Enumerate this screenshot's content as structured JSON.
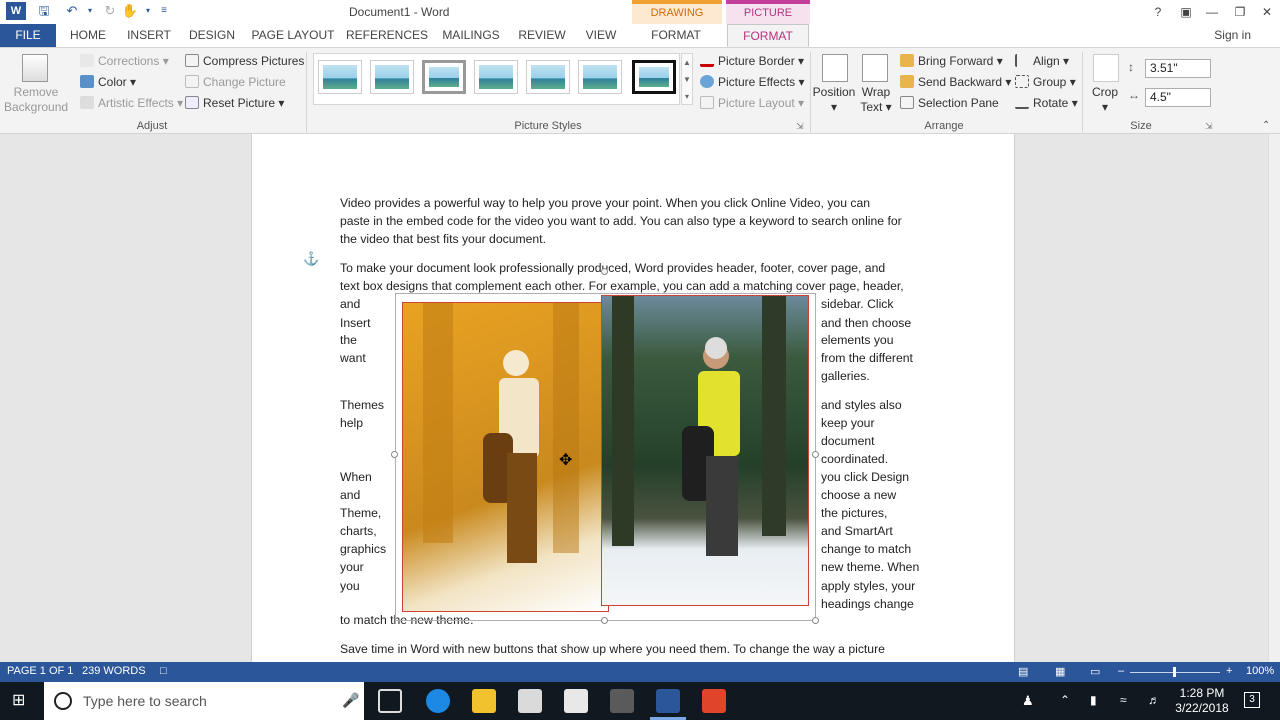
{
  "titlebar": {
    "document_title": "Document1 - Word",
    "context_drawing_tools": "DRAWING TOOLS",
    "context_picture_tools": "PICTURE TOOLS",
    "help": "?"
  },
  "tabs": {
    "file": "FILE",
    "home": "HOME",
    "insert": "INSERT",
    "design": "DESIGN",
    "page_layout": "PAGE LAYOUT",
    "references": "REFERENCES",
    "mailings": "MAILINGS",
    "review": "REVIEW",
    "view": "VIEW",
    "format_drawing": "FORMAT",
    "format_picture": "FORMAT",
    "sign_in": "Sign in"
  },
  "ribbon": {
    "adjust": {
      "remove_background": "Remove Background",
      "corrections": "Corrections",
      "color": "Color",
      "artistic_effects": "Artistic Effects",
      "compress_pictures": "Compress Pictures",
      "change_picture": "Change Picture",
      "reset_picture": "Reset Picture",
      "label": "Adjust"
    },
    "picture_styles": {
      "picture_border": "Picture Border",
      "picture_effects": "Picture Effects",
      "picture_layout": "Picture Layout",
      "label": "Picture Styles"
    },
    "arrange": {
      "position": "Position",
      "wrap_text": "Wrap Text",
      "bring_forward": "Bring Forward",
      "send_backward": "Send Backward",
      "selection_pane": "Selection Pane",
      "align": "Align",
      "group": "Group",
      "rotate": "Rotate",
      "label": "Arrange"
    },
    "size": {
      "crop": "Crop",
      "height": "3.51\"",
      "width": "4.5\"",
      "label": "Size"
    }
  },
  "document": {
    "para1": [
      "Video provides a powerful way to help you prove your point. When you click Online Video, you can",
      "paste in the embed code for the video you want to add. You can also type a keyword to search online for",
      "the video that best fits your document."
    ],
    "para2": [
      "To make your document look professionally produced, Word provides header, footer, cover page, and",
      "text box designs that complement each other. For example, you can add a matching cover page, header,"
    ],
    "wrap_left": [
      "and",
      "Insert",
      "the",
      "want",
      "Themes",
      "help",
      "When",
      "and",
      "Theme,",
      "charts,",
      "graphics",
      "your",
      "you"
    ],
    "wrap_right": [
      "sidebar. Click",
      "and then choose",
      "elements you",
      "from the different",
      "galleries.",
      "and styles also",
      "keep your",
      "document",
      "coordinated.",
      "you click Design",
      "choose a new",
      "the pictures,",
      "and SmartArt",
      "change to match",
      "new theme. When",
      "apply styles, your",
      "headings change"
    ],
    "para_after": "to match the new theme.",
    "para_last": "Save time in Word with new buttons that show up where you need them. To change the way a picture"
  },
  "statusbar": {
    "page": "PAGE 1 OF 1",
    "words": "239 WORDS",
    "zoom": "100%"
  },
  "taskbar": {
    "search_placeholder": "Type here to search",
    "time": "1:28 PM",
    "date": "3/22/2018",
    "notifications": "3"
  },
  "colors": {
    "word_blue": "#2b579a",
    "picture_tools": "#b5347f",
    "drawing_tools": "#d26b00"
  }
}
